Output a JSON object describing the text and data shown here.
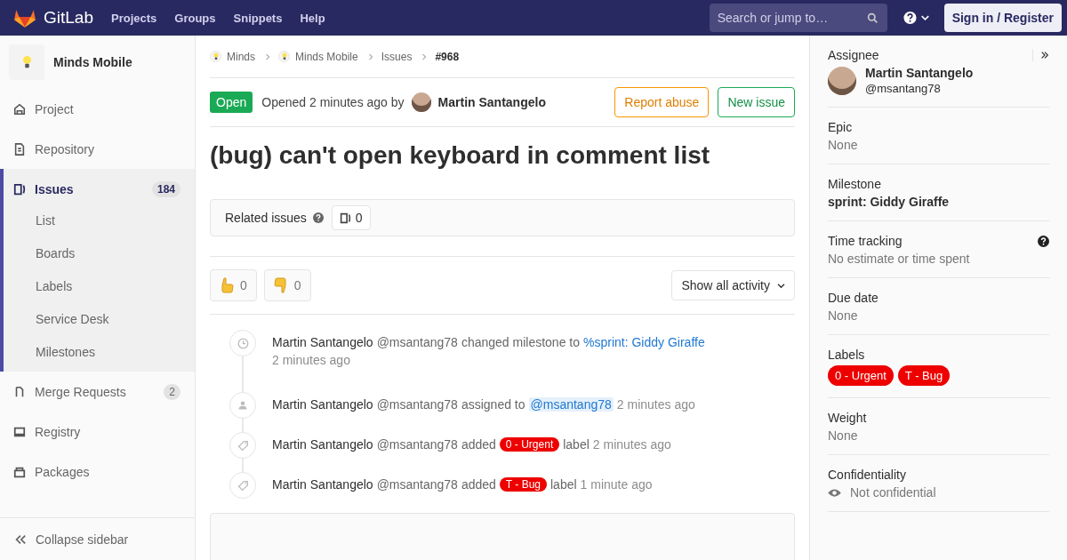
{
  "navbar": {
    "brand": "GitLab",
    "links": [
      "Projects",
      "Groups",
      "Snippets",
      "Help"
    ],
    "search": {
      "placeholder": "Search or jump to…"
    },
    "sign_in": "Sign in / Register"
  },
  "sidebar": {
    "project": "Minds Mobile",
    "items": [
      {
        "label": "Project",
        "kind": "home",
        "selected": false
      },
      {
        "label": "Repository",
        "kind": "doc",
        "selected": false
      },
      {
        "label": "Issues",
        "kind": "issues",
        "selected": true,
        "count": "184",
        "children": [
          {
            "label": "List",
            "selected": false
          },
          {
            "label": "Boards",
            "selected": false
          },
          {
            "label": "Labels",
            "selected": false
          },
          {
            "label": "Service Desk",
            "selected": false
          },
          {
            "label": "Milestones",
            "selected": false
          }
        ]
      },
      {
        "label": "Merge Requests",
        "kind": "merge",
        "selected": false,
        "count": "2"
      },
      {
        "label": "Registry",
        "kind": "registry",
        "selected": false
      },
      {
        "label": "Packages",
        "kind": "package",
        "selected": false
      }
    ],
    "collapse": "Collapse sidebar"
  },
  "breadcrumbs": [
    "Minds",
    "Minds Mobile",
    "Issues",
    "#968"
  ],
  "issue": {
    "status": "Open",
    "opened": "Opened 2 minutes ago by",
    "author": "Martin Santangelo",
    "buttons": [
      "Report abuse",
      "New issue"
    ],
    "title": "(bug) can't open keyboard in comment list",
    "related": {
      "label": "Related issues",
      "count": "0"
    },
    "reactions": [
      {
        "kind": "thumbsup",
        "count": "0"
      },
      {
        "kind": "thumbsdown",
        "count": "0"
      }
    ],
    "filter": "Show all activity"
  },
  "timeline": [
    {
      "kind": "milestone",
      "author": "Martin Santangelo",
      "handle": "@msantang78",
      "action": "changed milestone to",
      "link": "%sprint: Giddy Giraffe",
      "time": "2 minutes ago"
    },
    {
      "kind": "assign",
      "author": "Martin Santangelo",
      "handle": "@msantang78",
      "action": "assigned to",
      "mention": "@msantang78",
      "time": "2 minutes ago"
    },
    {
      "kind": "label",
      "author": "Martin Santangelo",
      "handle": "@msantang78",
      "action": "added",
      "label": {
        "text": "0 - Urgent",
        "color": "#ee0000"
      },
      "after": "label",
      "time": "2 minutes ago"
    },
    {
      "kind": "label",
      "author": "Martin Santangelo",
      "handle": "@msantang78",
      "action": "added",
      "label": {
        "text": "T - Bug",
        "color": "#ee0000"
      },
      "after": "label",
      "time": "1 minute ago"
    }
  ],
  "right": {
    "assignee": {
      "title": "Assignee",
      "name": "Martin Santangelo",
      "handle": "@msantang78"
    },
    "blocks": [
      {
        "kind": "text",
        "title": "Epic",
        "value": "None"
      },
      {
        "kind": "bold",
        "title": "Milestone",
        "value": "sprint: Giddy Giraffe"
      },
      {
        "kind": "help",
        "title": "Time tracking",
        "value": "No estimate or time spent"
      },
      {
        "kind": "text",
        "title": "Due date",
        "value": "None"
      },
      {
        "kind": "labels",
        "title": "Labels",
        "labels": [
          {
            "text": "0 - Urgent",
            "color": "#ee0000"
          },
          {
            "text": "T - Bug",
            "color": "#ee0000"
          }
        ]
      },
      {
        "kind": "text",
        "title": "Weight",
        "value": "None"
      },
      {
        "kind": "eye",
        "title": "Confidentiality",
        "value": "Not confidential"
      }
    ]
  }
}
